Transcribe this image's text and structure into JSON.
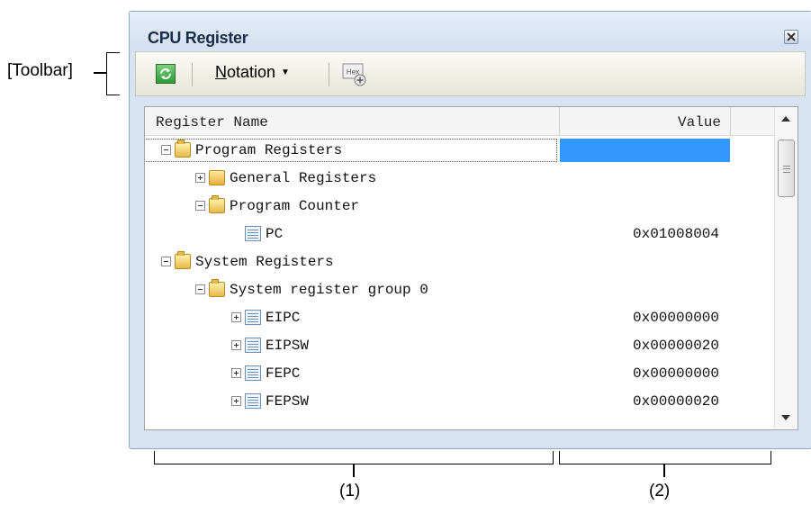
{
  "annotations": {
    "toolbar_label": "[Toolbar]",
    "area1_label": "(1)",
    "area2_label": "(2)"
  },
  "window": {
    "title": "CPU Register"
  },
  "toolbar": {
    "refresh_icon": "refresh-icon",
    "notation_label_underlined": "N",
    "notation_label_rest": "otation",
    "hex_icon_text": "Hex"
  },
  "table": {
    "columns": [
      "Register Name",
      "Value"
    ],
    "rows": [
      {
        "name": "Program Registers",
        "value": "",
        "level": 0,
        "expander": "minus",
        "icon": "folder-open-icon"
      },
      {
        "name": "General Registers",
        "value": "",
        "level": 1,
        "expander": "plus",
        "icon": "folder-closed-icon"
      },
      {
        "name": "Program Counter",
        "value": "",
        "level": 1,
        "expander": "minus",
        "icon": "folder-open-icon"
      },
      {
        "name": "PC",
        "value": "0x01008004",
        "level": 2,
        "expander": "none",
        "icon": "register-icon"
      },
      {
        "name": "System Registers",
        "value": "",
        "level": 0,
        "expander": "minus",
        "icon": "folder-open-icon"
      },
      {
        "name": "System register group 0",
        "value": "",
        "level": 1,
        "expander": "minus",
        "icon": "folder-open-icon"
      },
      {
        "name": "EIPC",
        "value": "0x00000000",
        "level": 2,
        "expander": "plus",
        "icon": "register-icon"
      },
      {
        "name": "EIPSW",
        "value": "0x00000020",
        "level": 2,
        "expander": "plus",
        "icon": "register-icon"
      },
      {
        "name": "FEPC",
        "value": "0x00000000",
        "level": 2,
        "expander": "plus",
        "icon": "register-icon"
      },
      {
        "name": "FEPSW",
        "value": "0x00000020",
        "level": 2,
        "expander": "plus",
        "icon": "register-icon"
      }
    ]
  },
  "colors": {
    "selection": "#3399ff",
    "window_bg": "#d6e3f3"
  }
}
